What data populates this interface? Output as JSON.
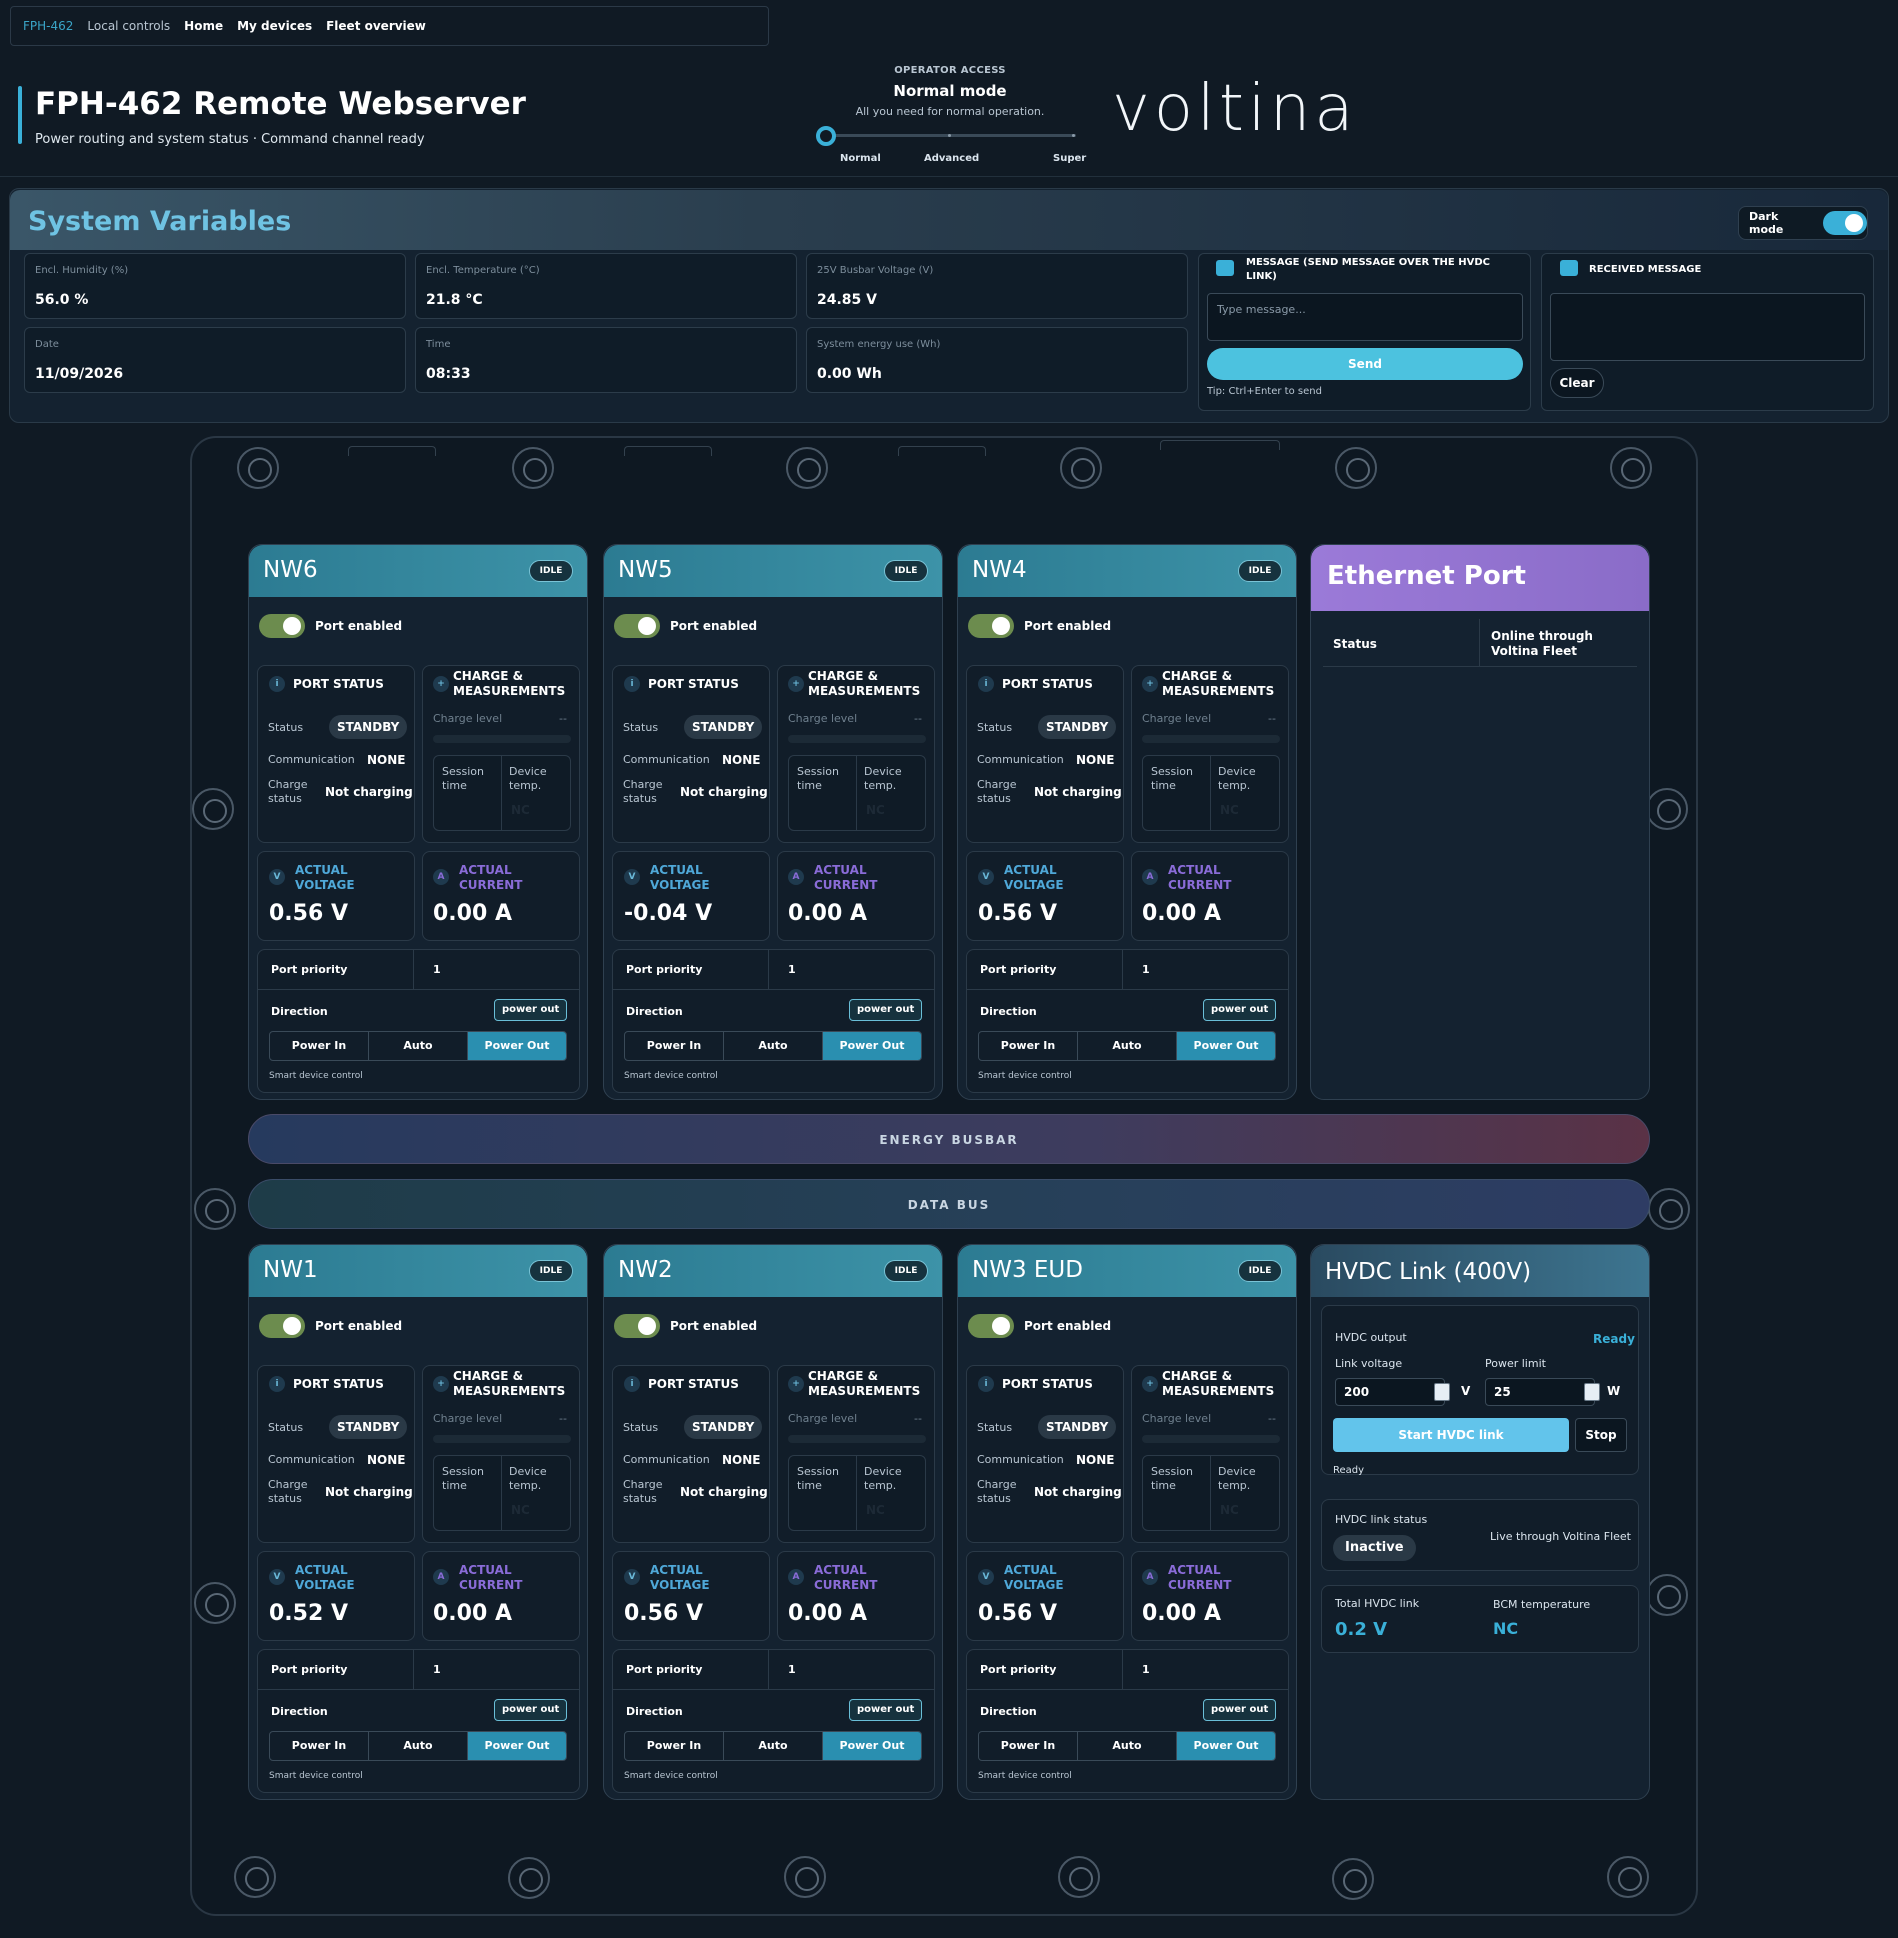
{
  "nav": {
    "brand": "FPH-462",
    "local": "Local controls",
    "home": "Home",
    "devices": "My devices",
    "fleet": "Fleet overview"
  },
  "header": {
    "title": "FPH-462 Remote Webserver",
    "subtitle": "Power routing and system status · Command channel ready"
  },
  "operator": {
    "label": "OPERATOR ACCESS",
    "mode": "Normal mode",
    "desc": "All you need for normal operation.",
    "levels": [
      "Normal",
      "Advanced",
      "Super"
    ]
  },
  "logo": "vo̲ltina",
  "system": {
    "title": "System Variables",
    "dark_mode": "Dark mode",
    "vars": [
      {
        "label": "Encl. Humidity (%)",
        "value": "56.0 %"
      },
      {
        "label": "Encl. Temperature (°C)",
        "value": "21.8 °C"
      },
      {
        "label": "25V Busbar Voltage (V)",
        "value": "24.85 V"
      },
      {
        "label": "Date",
        "value": "11/09/2026"
      },
      {
        "label": "Time",
        "value": "08:33"
      },
      {
        "label": "System energy use (Wh)",
        "value": "0.00 Wh"
      }
    ],
    "message": {
      "title": "MESSAGE (SEND MESSAGE OVER THE HVDC LINK)",
      "placeholder": "Type message...",
      "send": "Send",
      "tip": "Tip: Ctrl+Enter to send"
    },
    "received": {
      "title": "RECEIVED MESSAGE",
      "clear": "Clear"
    }
  },
  "card_labels": {
    "idle": "IDLE",
    "port_enabled": "Port enabled",
    "port_status": "PORT STATUS",
    "charge_meas": "CHARGE & MEASUREMENTS",
    "status": "Status",
    "standby": "STANDBY",
    "communication": "Communication",
    "none": "NONE",
    "charge_status": "Charge status",
    "not_charging": "Not charging",
    "charge_level": "Charge level",
    "dash": "--",
    "session_time": "Session time",
    "device_temp": "Device temp.",
    "nc": "NC",
    "actual_voltage": "ACTUAL VOLTAGE",
    "actual_current": "ACTUAL CURRENT",
    "v_icon": "V",
    "a_icon": "A",
    "i_icon": "i",
    "plus_icon": "+",
    "port_priority": "Port priority",
    "direction": "Direction",
    "power_out_badge": "power out",
    "power_in": "Power In",
    "auto": "Auto",
    "power_out": "Power Out",
    "smart": "Smart device control"
  },
  "ports": [
    {
      "name": "NW6",
      "voltage": "0.56 V",
      "current": "0.00 A",
      "priority": "1"
    },
    {
      "name": "NW5",
      "voltage": "-0.04 V",
      "current": "0.00 A",
      "priority": "1"
    },
    {
      "name": "NW4",
      "voltage": "0.56 V",
      "current": "0.00 A",
      "priority": "1"
    },
    {
      "name": "NW1",
      "voltage": "0.52 V",
      "current": "0.00 A",
      "priority": "1"
    },
    {
      "name": "NW2",
      "voltage": "0.56 V",
      "current": "0.00 A",
      "priority": "1"
    },
    {
      "name": "NW3 EUD",
      "voltage": "0.56 V",
      "current": "0.00 A",
      "priority": "1"
    }
  ],
  "ethernet": {
    "title": "Ethernet Port",
    "status_label": "Status",
    "status_value": "Online through Voltina Fleet"
  },
  "buses": {
    "energy": "ENERGY BUSBAR",
    "data": "DATA BUS"
  },
  "hvdc": {
    "title": "HVDC Link (400V)",
    "output_label": "HVDC output",
    "ready_badge": "Ready",
    "link_voltage_label": "Link voltage",
    "link_voltage": "200",
    "v_unit": "V",
    "power_limit_label": "Power limit",
    "power_limit": "25",
    "w_unit": "W",
    "start": "Start HVDC link",
    "stop": "Stop",
    "ready_text": "Ready",
    "link_status_label": "HVDC link status",
    "link_status": "Inactive",
    "live": "Live through Voltina Fleet",
    "total_label": "Total HVDC link",
    "total": "0.2 V",
    "bcm_label": "BCM temperature",
    "bcm": "NC"
  },
  "colors": {
    "accent": "#3ab0d8",
    "toggle_on": "#6c8c4e",
    "ethernet": "#9b7ad8",
    "voltage_title": "#4fa8d8",
    "current_title": "#8a6cd8"
  }
}
